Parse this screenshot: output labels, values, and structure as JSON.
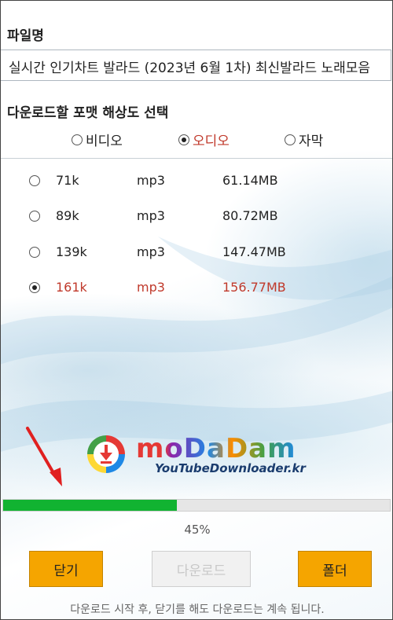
{
  "file": {
    "label": "파일명",
    "name": "실시간 인기차트 발라드 (2023년 6월 1차) 최신발라드 노래모음"
  },
  "format_select": {
    "title": "다운로드할 포맷 해상도 선택",
    "tabs": [
      {
        "label": "비디오",
        "selected": false
      },
      {
        "label": "오디오",
        "selected": true
      },
      {
        "label": "자막",
        "selected": false
      }
    ]
  },
  "options": [
    {
      "bitrate": "71k",
      "format": "mp3",
      "size": "61.14MB",
      "selected": false
    },
    {
      "bitrate": "89k",
      "format": "mp3",
      "size": "80.72MB",
      "selected": false
    },
    {
      "bitrate": "139k",
      "format": "mp3",
      "size": "147.47MB",
      "selected": false
    },
    {
      "bitrate": "161k",
      "format": "mp3",
      "size": "156.77MB",
      "selected": true
    }
  ],
  "logo": {
    "word": "moDaDam",
    "url": "YouTubeDownloader.kr"
  },
  "progress": {
    "value": 45,
    "text": "45%"
  },
  "buttons": {
    "close": "닫기",
    "download": "다운로드",
    "folder": "폴더"
  },
  "footer_note": "다운로드 시작 후, 닫기를 해도 다운로드는 계속 됩니다.",
  "colors": {
    "accent_red": "#c0392b",
    "progress_green": "#11b331",
    "button_orange": "#f5a500"
  },
  "icons": {
    "logo": "download-circle-icon",
    "annotation": "red-arrow-icon"
  }
}
